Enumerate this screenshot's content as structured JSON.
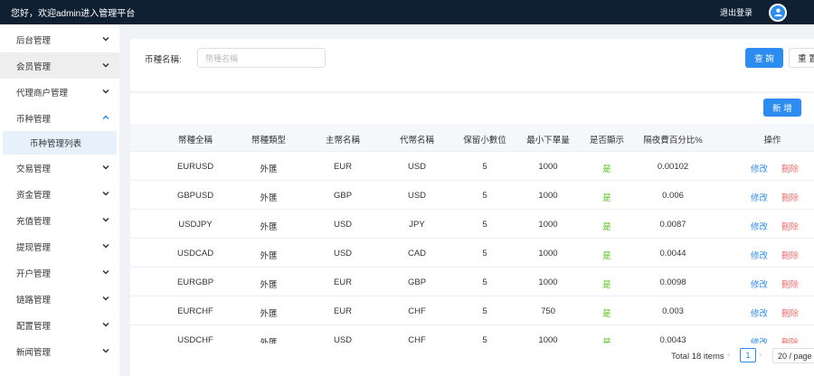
{
  "topbar": {
    "welcome": "您好，欢迎admin进入管理平台",
    "logout": "退出登录",
    "avatar_icon": "user-avatar-icon"
  },
  "sidebar": {
    "items": [
      {
        "label": "后台管理",
        "expanded": false
      },
      {
        "label": "会员管理",
        "expanded": false,
        "highlighted": true
      },
      {
        "label": "代理商户管理",
        "expanded": false
      },
      {
        "label": "币种管理",
        "expanded": true
      },
      {
        "label": "交易管理",
        "expanded": false
      },
      {
        "label": "资金管理",
        "expanded": false
      },
      {
        "label": "充值管理",
        "expanded": false
      },
      {
        "label": "提现管理",
        "expanded": false
      },
      {
        "label": "开户管理",
        "expanded": false
      },
      {
        "label": "链路管理",
        "expanded": false
      },
      {
        "label": "配置管理",
        "expanded": false
      },
      {
        "label": "新闻管理",
        "expanded": false
      }
    ],
    "subitem": {
      "label": "币种管理列表",
      "active": true
    }
  },
  "search": {
    "label": "币種名稱:",
    "placeholder": "幣種名稱",
    "query_button": "查 詢",
    "reset_button": "重 置"
  },
  "toolbar": {
    "add_button": "新 增"
  },
  "table": {
    "columns": [
      "幣種全稱",
      "幣種類型",
      "主幣名稱",
      "代幣名稱",
      "保留小數位",
      "最小下單量",
      "是否顯示",
      "隔夜費百分比%",
      "操作"
    ],
    "rows": [
      {
        "full": "EURUSD",
        "type": "外匯",
        "main": "EUR",
        "token": "USD",
        "decimals": "5",
        "min": "1000",
        "show": "是",
        "fee": "0.00102",
        "edit": "修改",
        "del": "刪除"
      },
      {
        "full": "GBPUSD",
        "type": "外匯",
        "main": "GBP",
        "token": "USD",
        "decimals": "5",
        "min": "1000",
        "show": "是",
        "fee": "0.006",
        "edit": "修改",
        "del": "刪除"
      },
      {
        "full": "USDJPY",
        "type": "外匯",
        "main": "USD",
        "token": "JPY",
        "decimals": "5",
        "min": "1000",
        "show": "是",
        "fee": "0.0087",
        "edit": "修改",
        "del": "刪除"
      },
      {
        "full": "USDCAD",
        "type": "外匯",
        "main": "USD",
        "token": "CAD",
        "decimals": "5",
        "min": "1000",
        "show": "是",
        "fee": "0.0044",
        "edit": "修改",
        "del": "刪除"
      },
      {
        "full": "EURGBP",
        "type": "外匯",
        "main": "EUR",
        "token": "GBP",
        "decimals": "5",
        "min": "1000",
        "show": "是",
        "fee": "0.0098",
        "edit": "修改",
        "del": "刪除"
      },
      {
        "full": "EURCHF",
        "type": "外匯",
        "main": "EUR",
        "token": "CHF",
        "decimals": "5",
        "min": "750",
        "show": "是",
        "fee": "0.003",
        "edit": "修改",
        "del": "刪除"
      },
      {
        "full": "USDCHF",
        "type": "外匯",
        "main": "USD",
        "token": "CHF",
        "decimals": "5",
        "min": "1000",
        "show": "是",
        "fee": "0.0043",
        "edit": "修改",
        "del": "刪除"
      }
    ]
  },
  "pagination": {
    "total": "Total 18 items",
    "current_page": "1",
    "page_size": "20 / page"
  },
  "colors": {
    "topbar": "#0f2033",
    "primary": "#2d8cf0",
    "yes": "#52c41a",
    "delete": "#f56c6c"
  }
}
